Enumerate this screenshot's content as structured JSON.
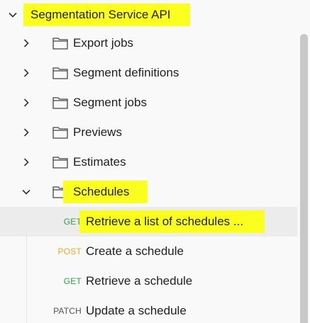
{
  "tree": {
    "root": {
      "label": "Segmentation Service API"
    },
    "folders": [
      {
        "label": "Export jobs"
      },
      {
        "label": "Segment definitions"
      },
      {
        "label": "Segment jobs"
      },
      {
        "label": "Previews"
      },
      {
        "label": "Estimates"
      },
      {
        "label": "Schedules"
      }
    ],
    "requests": [
      {
        "method": "GET",
        "label": "Retrieve a list of schedules ..."
      },
      {
        "method": "POST",
        "label": "Create a schedule"
      },
      {
        "method": "GET",
        "label": "Retrieve a schedule"
      },
      {
        "method": "PATCH",
        "label": "Update a schedule"
      }
    ]
  },
  "colors": {
    "highlight": "#fbff1e",
    "get": "#2f9e44",
    "post": "#f5a623",
    "patch": "#555555",
    "selected_row": "#ececec"
  },
  "icons": {
    "collapsed": "chevron-right-icon",
    "expanded": "chevron-down-icon",
    "folder": "folder-icon"
  }
}
